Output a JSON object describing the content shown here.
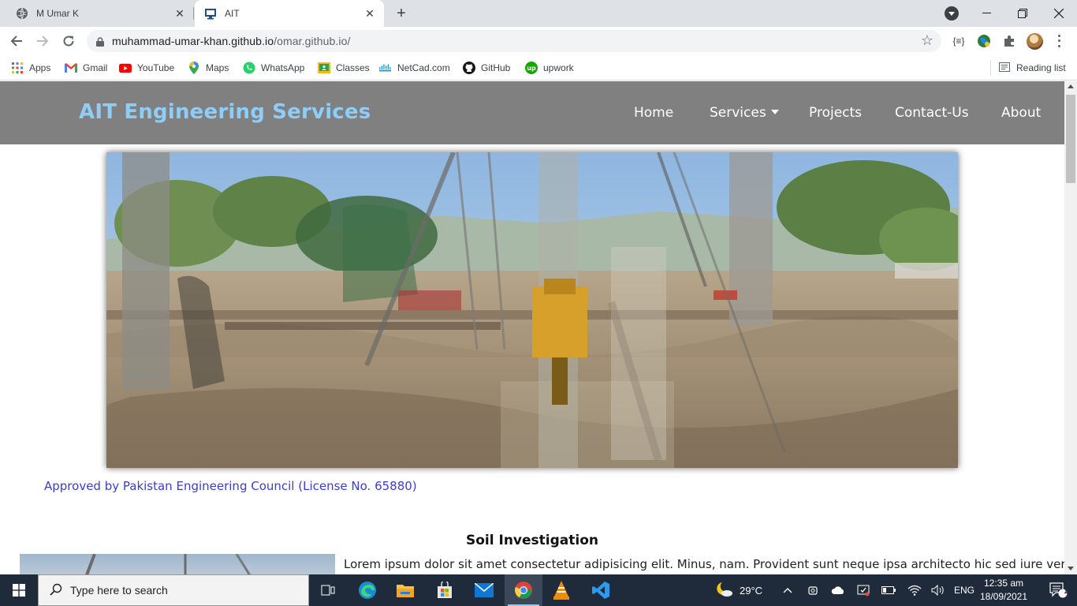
{
  "browser": {
    "tabs": [
      {
        "title": "M Umar K",
        "active": false
      },
      {
        "title": "AIT",
        "active": true
      }
    ],
    "url_host": "muhammad-umar-khan.github.io",
    "url_path": "/omar.github.io/",
    "bookmarks": [
      "Apps",
      "Gmail",
      "YouTube",
      "Maps",
      "WhatsApp",
      "Classes",
      "NetCad.com",
      "GitHub",
      "upwork"
    ],
    "reading_list": "Reading list"
  },
  "site": {
    "brand": "AIT Engineering Services",
    "nav": [
      "Home",
      "Services",
      "Projects",
      "Contact-Us",
      "About"
    ],
    "approval": "Approved by Pakistan Engineering Council (License No. 65880)",
    "section_title": "Soil Investigation",
    "section_text": "Lorem ipsum dolor sit amet consectetur adipisicing elit. Minus, nam. Provident sunt neque ipsa architecto hic sed iure vero."
  },
  "taskbar": {
    "search_placeholder": "Type here to search",
    "weather": "29°C",
    "language": "ENG",
    "time": "12:35 am",
    "date": "18/09/2021",
    "notifications": "11"
  },
  "colors": {
    "brand": "#8ecdf7",
    "nav_bg": "#808080",
    "approval_text": "#3b3bd6",
    "taskbar_bg": "#1f2b3a"
  }
}
